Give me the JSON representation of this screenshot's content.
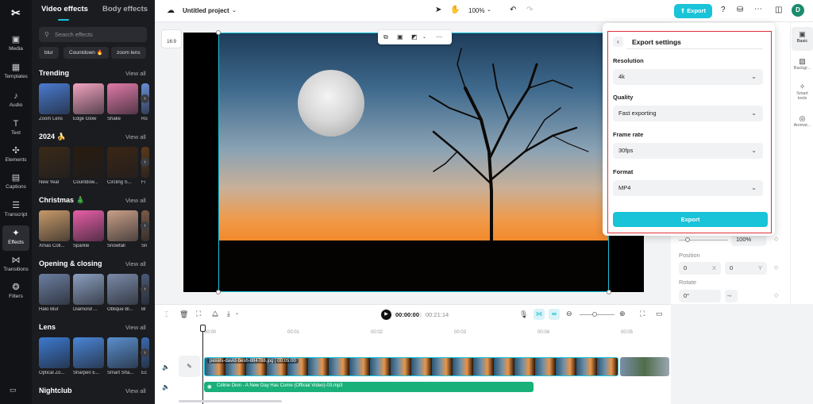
{
  "rail": {
    "items": [
      {
        "label": "Media",
        "icon": "media-icon",
        "glyph": "▣"
      },
      {
        "label": "Templates",
        "icon": "templates-icon",
        "glyph": "▦"
      },
      {
        "label": "Audio",
        "icon": "audio-icon",
        "glyph": "♪"
      },
      {
        "label": "Text",
        "icon": "text-icon",
        "glyph": "T"
      },
      {
        "label": "Elements",
        "icon": "elements-icon",
        "glyph": "✣"
      },
      {
        "label": "Captions",
        "icon": "captions-icon",
        "glyph": "▤"
      },
      {
        "label": "Transcript",
        "icon": "transcript-icon",
        "glyph": "☰"
      },
      {
        "label": "Effects",
        "icon": "effects-icon",
        "glyph": "✦"
      },
      {
        "label": "Transitions",
        "icon": "transitions-icon",
        "glyph": "⋈"
      },
      {
        "label": "Filters",
        "icon": "filters-icon",
        "glyph": "❂"
      }
    ]
  },
  "panel": {
    "tab_active": "Video effects",
    "tab_other": "Body effects",
    "search_placeholder": "Search effects",
    "chips": [
      "blur",
      "Countdown 🔥",
      "zoom lens"
    ],
    "view_all": "View all",
    "sections": [
      {
        "title": "Trending",
        "items": [
          "Zoom Lens",
          "Edge Glow",
          "Shake",
          "Ro"
        ]
      },
      {
        "title": "2024 🍌",
        "items": [
          "New Year",
          "Countdow...",
          "Circling S...",
          "Fi"
        ]
      },
      {
        "title": "Christmas 🎄",
        "items": [
          "Xmas Coll...",
          "Sparkle",
          "Snowfall",
          "Sn"
        ]
      },
      {
        "title": "Opening & closing",
        "items": [
          "Halo Blur",
          "Diamond ...",
          "Oblique Bl...",
          "Bl"
        ]
      },
      {
        "title": "Lens",
        "items": [
          "Optical Zo...",
          "Sharpen E...",
          "Smart Sha...",
          "Ec"
        ]
      },
      {
        "title": "Nightclub",
        "items": []
      }
    ]
  },
  "topbar": {
    "project_title": "Untitled project",
    "zoom": "100%",
    "export_label": "Export",
    "avatar_letter": "D"
  },
  "canvas": {
    "ratio": "16:9"
  },
  "props": {
    "scale_value": "100%",
    "position_label": "Position",
    "pos_x": "0",
    "pos_x_axis": "X",
    "pos_y": "0",
    "pos_y_axis": "Y",
    "rotate_label": "Rotate",
    "rotate_value": "0°"
  },
  "rtabs": [
    {
      "label": "Basic",
      "icon": "basic-icon",
      "glyph": "▣"
    },
    {
      "label": "Backgr...",
      "icon": "background-icon",
      "glyph": "▧"
    },
    {
      "label": "Smart tools",
      "icon": "smart-tools-icon",
      "glyph": "✧"
    },
    {
      "label": "Animat...",
      "icon": "animation-icon",
      "glyph": "◎"
    }
  ],
  "export": {
    "title": "Export settings",
    "resolution_label": "Resolution",
    "resolution_value": "4k",
    "quality_label": "Quality",
    "quality_value": "Fast exporting",
    "framerate_label": "Frame rate",
    "framerate_value": "30fps",
    "format_label": "Format",
    "format_value": "MP4",
    "button_label": "Export"
  },
  "timeline": {
    "current_time": "00:00:00",
    "separator": "|",
    "total_time": "00:21:14",
    "ruler": [
      "00:00",
      "00:01",
      "00:02",
      "00:03",
      "00:04",
      "00:05"
    ],
    "video_clip": "pexels-david-besh-884788.jpg",
    "video_clip_duration": "00:05:00",
    "audio_clip": "Céline Dion - A New Day Has Come (Official Video)-03.mp3"
  },
  "colors": {
    "accent": "#19c3d8",
    "audio": "#19b07a",
    "highlight_box": "#e0303a"
  }
}
